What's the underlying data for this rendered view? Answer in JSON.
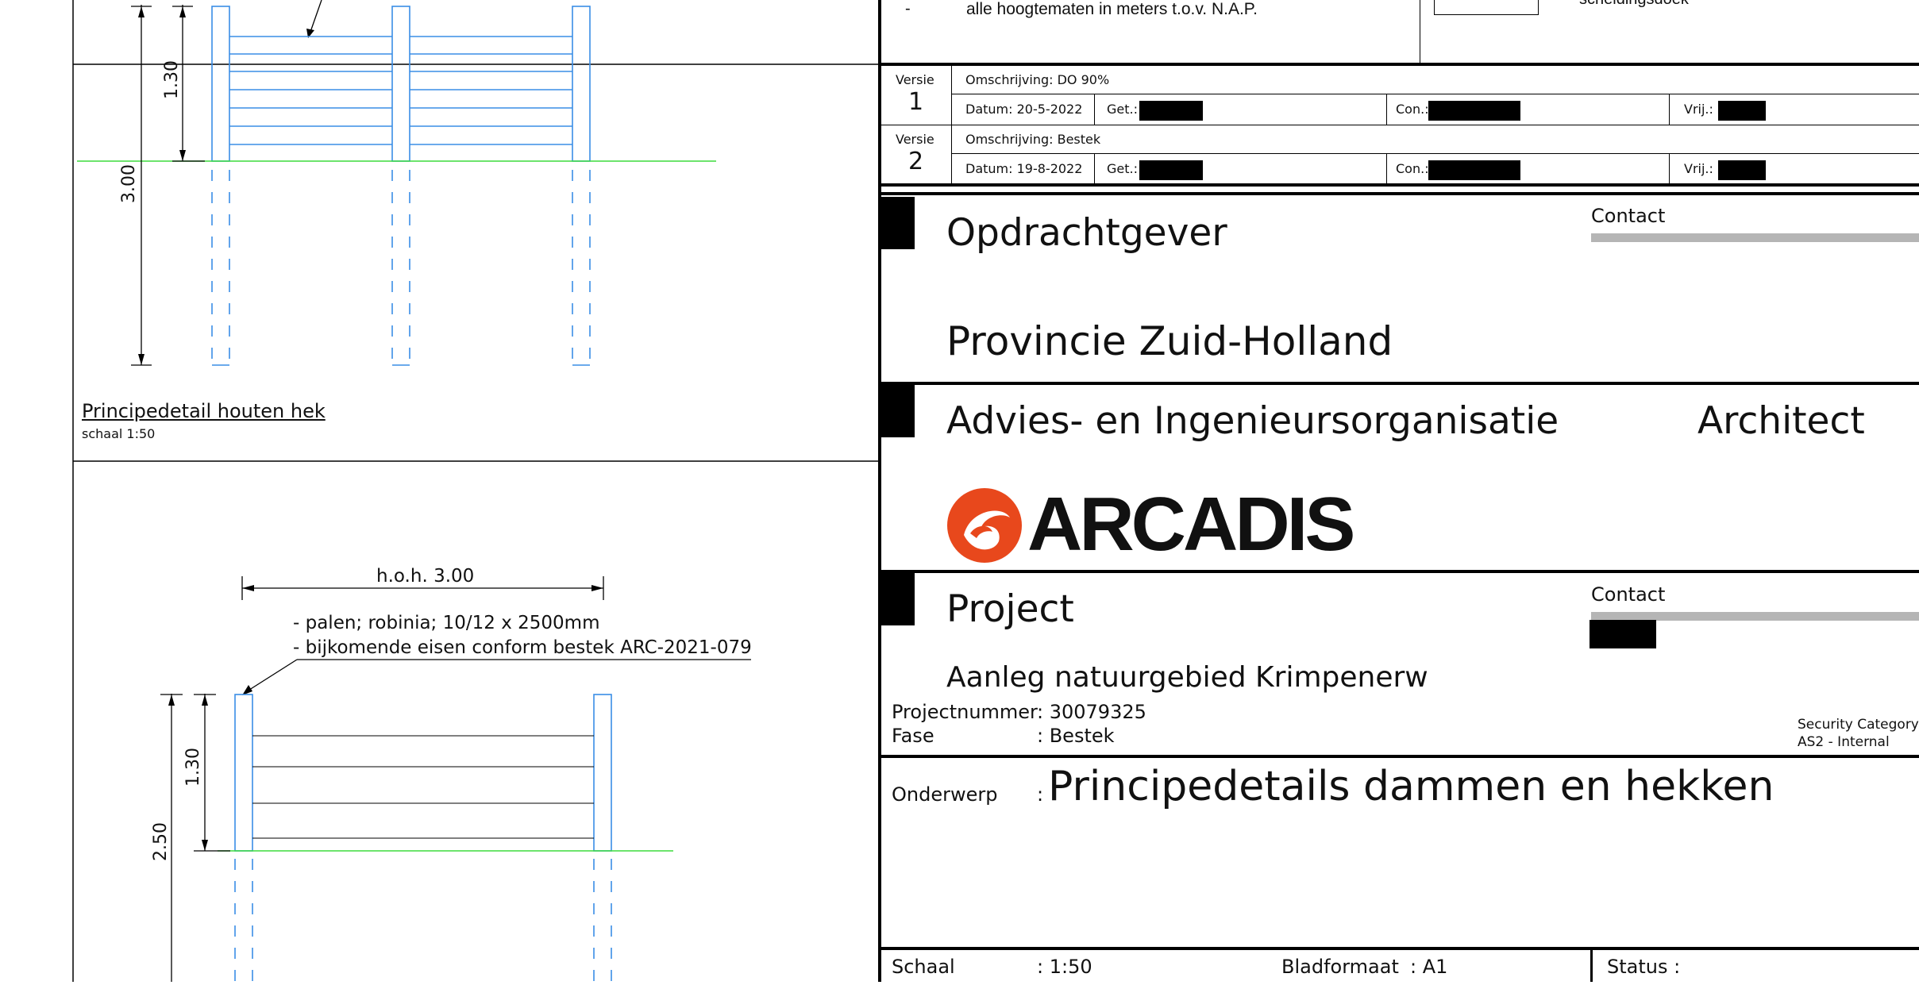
{
  "drawing": {
    "detail1": {
      "title": "Principedetail houten hek",
      "scale": "schaal 1:50",
      "dim_post_height": "1.30",
      "dim_total": "3.00"
    },
    "detail2": {
      "dim_spacing": "h.o.h. 3.00",
      "note_line1": "- palen; robinia; 10/12 x 2500mm",
      "note_line2": "- bijkomende eisen conform bestek ARC-2021-079",
      "dim_post_height": "1.30",
      "dim_total": "2.50"
    }
  },
  "legend": {
    "dash": "-",
    "note": "alle hoogtematen in meters t.o.v. N.A.P.",
    "cut_label": "scheidingsdoek"
  },
  "versions": [
    {
      "label": "Versie",
      "number": "1",
      "description": "Omschrijving: DO 90%",
      "date": "Datum: 20-5-2022",
      "drawn_label": "Get.:",
      "checked_label": "Con.:",
      "released_label": "Vrij.:"
    },
    {
      "label": "Versie",
      "number": "2",
      "description": "Omschrijving: Bestek",
      "date": "Datum: 19-8-2022",
      "drawn_label": "Get.:",
      "checked_label": "Con.:",
      "released_label": "Vrij.:"
    }
  ],
  "client": {
    "heading": "Opdrachtgever",
    "contact_label": "Contact",
    "name": "Provincie Zuid-Holland"
  },
  "consultant": {
    "heading": "Advies- en Ingenieursorganisatie",
    "architect_label": "Architect",
    "logo_text": "ARCADIS"
  },
  "project": {
    "heading": "Project",
    "contact_label": "Contact",
    "name": "Aanleg natuurgebied Krimpenerw",
    "number_label": "Projectnummer",
    "number_value": ": 30079325",
    "phase_label": "Fase",
    "phase_value": ": Bestek",
    "security_line1": "Security Category:",
    "security_line2": "AS2 - Internal"
  },
  "subject": {
    "label": "Onderwerp",
    "colon": ":",
    "value": "Principedetails dammen en hekken"
  },
  "footer": {
    "scale_label": "Schaal",
    "scale_value": ": 1:50",
    "format_label": "Bladformaat",
    "format_value": ": A1",
    "status_label": "Status :"
  },
  "colors": {
    "construction_blue": "#3a8ee6",
    "ground_green": "#3ddc3d",
    "logo_orange": "#e8481c",
    "frame_black": "#000000"
  }
}
